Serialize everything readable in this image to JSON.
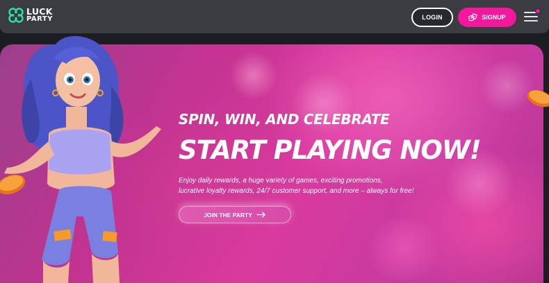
{
  "header": {
    "logo": {
      "line1": "LUCK",
      "line2": "PARTY",
      "icon": "clover-icon",
      "color": "#2fe0a2"
    },
    "login_label": "LOGIN",
    "signup_label": "SIGNUP",
    "signup_icon": "dice-icon",
    "menu_icon": "hamburger-icon",
    "notification_dot_color": "#f2189c"
  },
  "hero": {
    "subtitle": "SPIN, WIN, AND CELEBRATE",
    "title": "START PLAYING NOW!",
    "description_line1": "Enjoy daily rewards, a huge variety of games, exciting promotions,",
    "description_line2": "lucrative loyalty rewards, 24/7 customer support, and more – always for free!",
    "cta_label": "JOIN THE PARTY",
    "cta_icon": "arrow-right-icon"
  },
  "colors": {
    "brand_pink": "#f2189c",
    "topbar_bg": "#3a3c42",
    "page_bg": "#1b1d22"
  }
}
